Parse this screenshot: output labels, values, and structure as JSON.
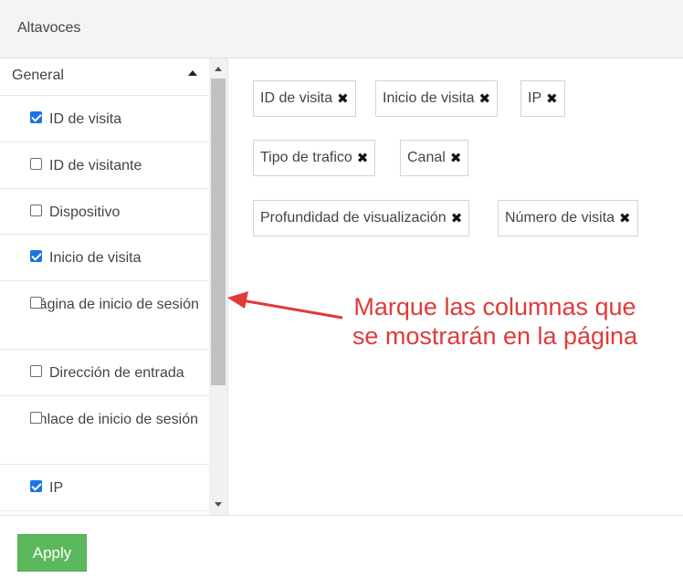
{
  "header": {
    "title": "Altavoces"
  },
  "sidebar": {
    "group": "General",
    "items": [
      {
        "label": "ID de visita",
        "checked": true
      },
      {
        "label": "ID de visitante",
        "checked": false
      },
      {
        "label": "Dispositivo",
        "checked": false
      },
      {
        "label": "Inicio de visita",
        "checked": true
      },
      {
        "label": "Página de inicio de sesión",
        "checked": false
      },
      {
        "label": "Dirección de entrada",
        "checked": false
      },
      {
        "label": "Enlace de inicio de sesión",
        "checked": false
      },
      {
        "label": "IP",
        "checked": true
      }
    ]
  },
  "tags": [
    {
      "label": "ID de visita",
      "remove": "✖"
    },
    {
      "label": "Inicio de visita",
      "remove": "✖"
    },
    {
      "label": "IP",
      "remove": "✖"
    },
    {
      "label": "Tipo de trafico",
      "remove": "✖"
    },
    {
      "label": "Canal",
      "remove": "✖"
    },
    {
      "label": "Profundidad de visualización",
      "remove": "✖"
    },
    {
      "label": "Número de visita",
      "remove": "✖"
    }
  ],
  "annotation": {
    "line1": "Marque las columnas que",
    "line2": "se mostrarán en la página"
  },
  "footer": {
    "apply_label": "Apply"
  },
  "colors": {
    "accent": "#1a73e8",
    "apply": "#5cb85c",
    "annotation": "#e03a3a"
  }
}
